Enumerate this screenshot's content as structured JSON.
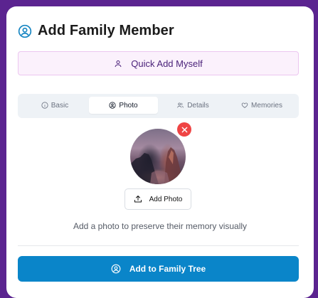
{
  "dialog": {
    "title": "Add Family Member",
    "quick_add_label": "Quick Add Myself",
    "tabs": [
      {
        "label": "Basic",
        "icon": "info-icon",
        "active": false
      },
      {
        "label": "Photo",
        "icon": "camera-icon",
        "active": true
      },
      {
        "label": "Details",
        "icon": "users-icon",
        "active": false
      },
      {
        "label": "Memories",
        "icon": "heart-icon",
        "active": false
      }
    ],
    "add_photo_label": "Add Photo",
    "hint": "Add a photo to preserve their memory visually",
    "submit_label": "Add to Family Tree"
  },
  "colors": {
    "background": "#5b2490",
    "accent": "#0a85c9",
    "remove": "#ef4444",
    "quick_bg": "#fbf1fc"
  }
}
